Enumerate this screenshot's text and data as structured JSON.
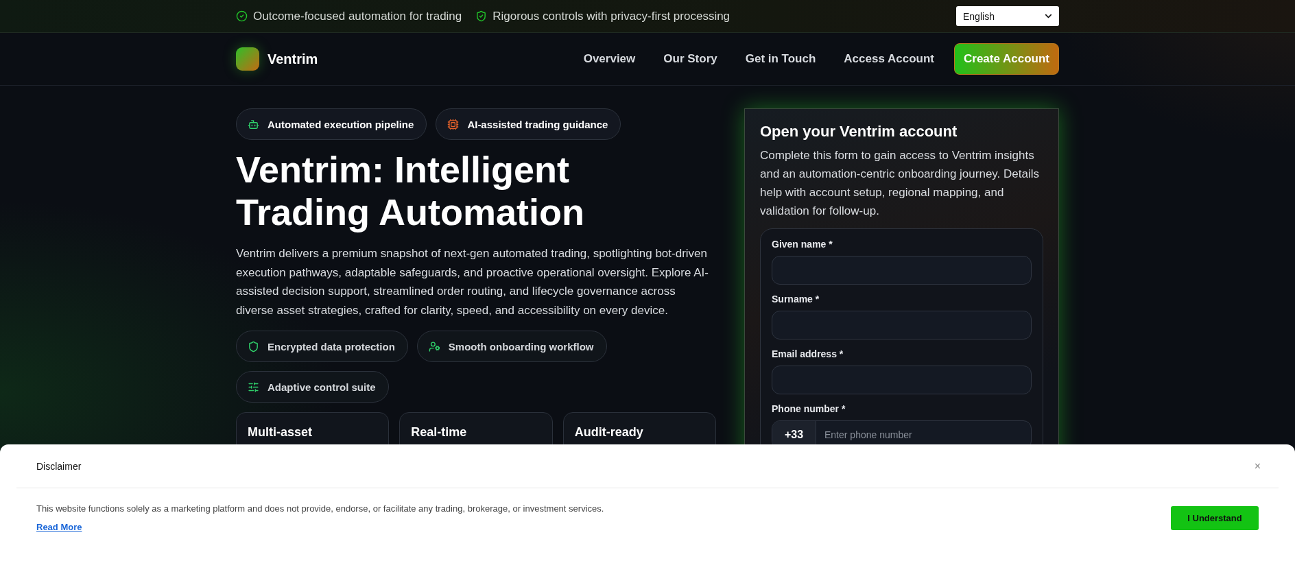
{
  "topbar": {
    "highlights": [
      {
        "text": "Outcome-focused automation for trading"
      },
      {
        "text": "Rigorous controls with privacy-first processing"
      }
    ],
    "language": "English"
  },
  "nav": {
    "brand": "Ventrim",
    "links": [
      "Overview",
      "Our Story",
      "Get in Touch",
      "Access Account"
    ],
    "cta": "Create Account"
  },
  "hero": {
    "badges": [
      {
        "text": "Automated execution pipeline"
      },
      {
        "text": "AI-assisted trading guidance"
      }
    ],
    "title": "Ventrim: Intelligent Trading Automation",
    "description": "Ventrim delivers a premium snapshot of next-gen automated trading, spotlighting bot-driven execution pathways, adaptable safeguards, and proactive operational oversight. Explore AI-assisted decision support, streamlined order routing, and lifecycle governance across diverse asset strategies, crafted for clarity, speed, and accessibility on every device.",
    "features": [
      {
        "text": "Encrypted data protection"
      },
      {
        "text": "Smooth onboarding workflow"
      },
      {
        "text": "Adaptive control suite"
      }
    ],
    "cards": [
      {
        "title": "Multi-asset"
      },
      {
        "title": "Real-time"
      },
      {
        "title": "Audit-ready"
      }
    ]
  },
  "form": {
    "title": "Open your Ventrim account",
    "description": "Complete this form to gain access to Ventrim insights and an automation-centric onboarding journey. Details help with account setup, regional mapping, and validation for follow-up.",
    "fields": [
      {
        "label": "Given name *",
        "kind": "text"
      },
      {
        "label": "Surname *",
        "kind": "text"
      },
      {
        "label": "Email address *",
        "kind": "text"
      },
      {
        "label": "Phone number *",
        "kind": "phone",
        "prefix": "+33",
        "placeholder": "Enter phone number"
      }
    ]
  },
  "disclaimer": {
    "title": "Disclaimer",
    "close": "×",
    "text": "This website functions solely as a marketing platform and does not provide, endorse, or facilitate any trading, brokerage, or investment services.",
    "link": "Read More",
    "button": "I Understand"
  }
}
